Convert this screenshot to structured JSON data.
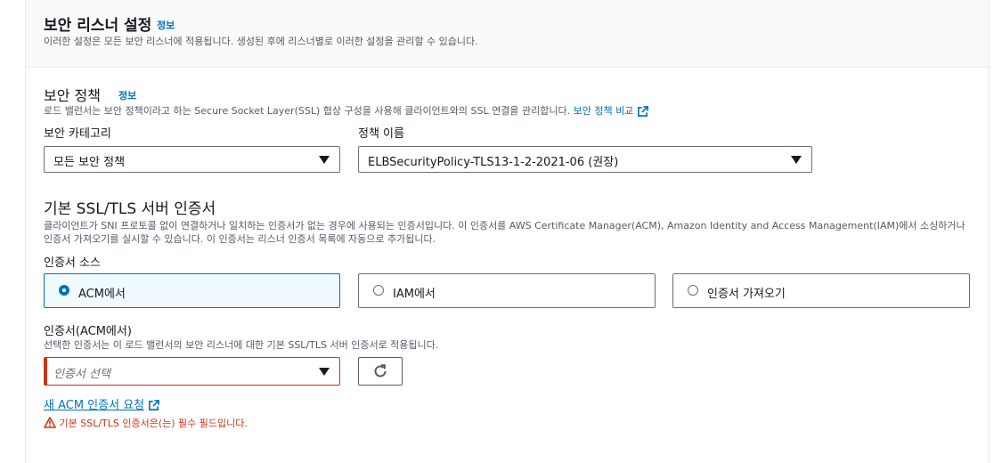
{
  "header": {
    "title": "보안 리스너 설정",
    "info_label": "정보",
    "description": "이러한 설정은 모든 보안 리스너에 적용됩니다. 생성된 후에 리스너별로 이러한 설정을 관리할 수 있습니다."
  },
  "security_policy": {
    "title": "보안 정책",
    "info_label": "정보",
    "description": "로드 밸런서는 보안 정책이라고 하는 Secure Socket Layer(SSL) 협상 구성을 사용해 클라이언트와의 SSL 연결을 관리합니다.",
    "compare_link": "보안 정책 비교",
    "category_label": "보안 카테고리",
    "category_value": "모든 보안 정책",
    "policy_name_label": "정책 이름",
    "policy_name_value": "ELBSecurityPolicy-TLS13-1-2-2021-06 (권장)"
  },
  "certificate": {
    "title": "기본 SSL/TLS 서버 인증서",
    "description_line1": "클라이언트가 SNI 프로토콜 없이 연결하거나 일치하는 인증서가 없는 경우에 사용되는 인증서입니다. 이 인증서를 AWS Certificate Manager(ACM), Amazon Identity and Access Management(IAM)에서 소싱하거나",
    "description_line2": "인증서 가져오기를 실시할 수 있습니다. 이 인증서는 리스너 인증서 목록에 자동으로 추가됩니다.",
    "source_label": "인증서 소스",
    "source_options": [
      "ACM에서",
      "IAM에서",
      "인증서 가져오기"
    ],
    "selected_source": "ACM에서",
    "acm_label": "인증서(ACM에서)",
    "acm_description": "선택한 인증서는 이 로드 밸런서의 보안 리스너에 대한 기본 SSL/TLS 서버 인증서로 적용됩니다.",
    "acm_placeholder": "인증서 선택",
    "request_link": "새 ACM 인증서 요청",
    "error_message": "기본 SSL/TLS 인증서은(는) 필수 필드입니다."
  },
  "colors": {
    "link": "#0073bb",
    "error": "#d13212",
    "selected_tile_bg": "#f1faff"
  }
}
